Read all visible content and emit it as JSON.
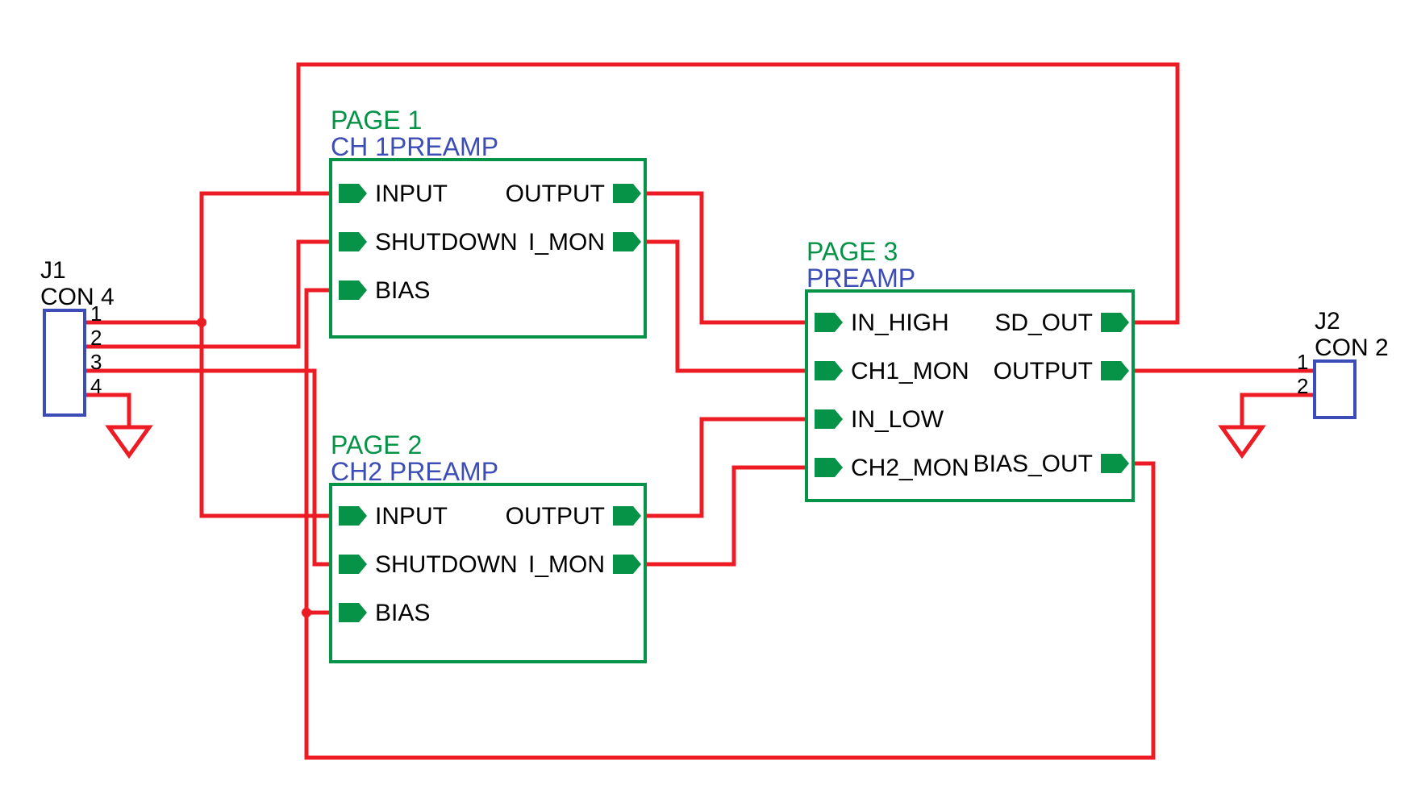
{
  "connectors": {
    "j1": {
      "ref": "J1",
      "type": "CON 4",
      "pins": [
        "1",
        "2",
        "3",
        "4"
      ]
    },
    "j2": {
      "ref": "J2",
      "type": "CON 2",
      "pins": [
        "1",
        "2"
      ]
    }
  },
  "blocks": {
    "b1": {
      "page": "PAGE 1",
      "name": "CH 1PREAMP",
      "left": [
        "INPUT",
        "SHUTDOWN",
        "BIAS"
      ],
      "right": [
        "OUTPUT",
        "I_MON"
      ]
    },
    "b2": {
      "page": "PAGE 2",
      "name": "CH2 PREAMP",
      "left": [
        "INPUT",
        "SHUTDOWN",
        "BIAS"
      ],
      "right": [
        "OUTPUT",
        "I_MON"
      ]
    },
    "b3": {
      "page": "PAGE 3",
      "name": "PREAMP",
      "left": [
        "IN_HIGH",
        "CH1_MON",
        "IN_LOW",
        "CH2_MON"
      ],
      "right": [
        "SD_OUT",
        "OUTPUT",
        "BIAS_OUT"
      ]
    }
  }
}
